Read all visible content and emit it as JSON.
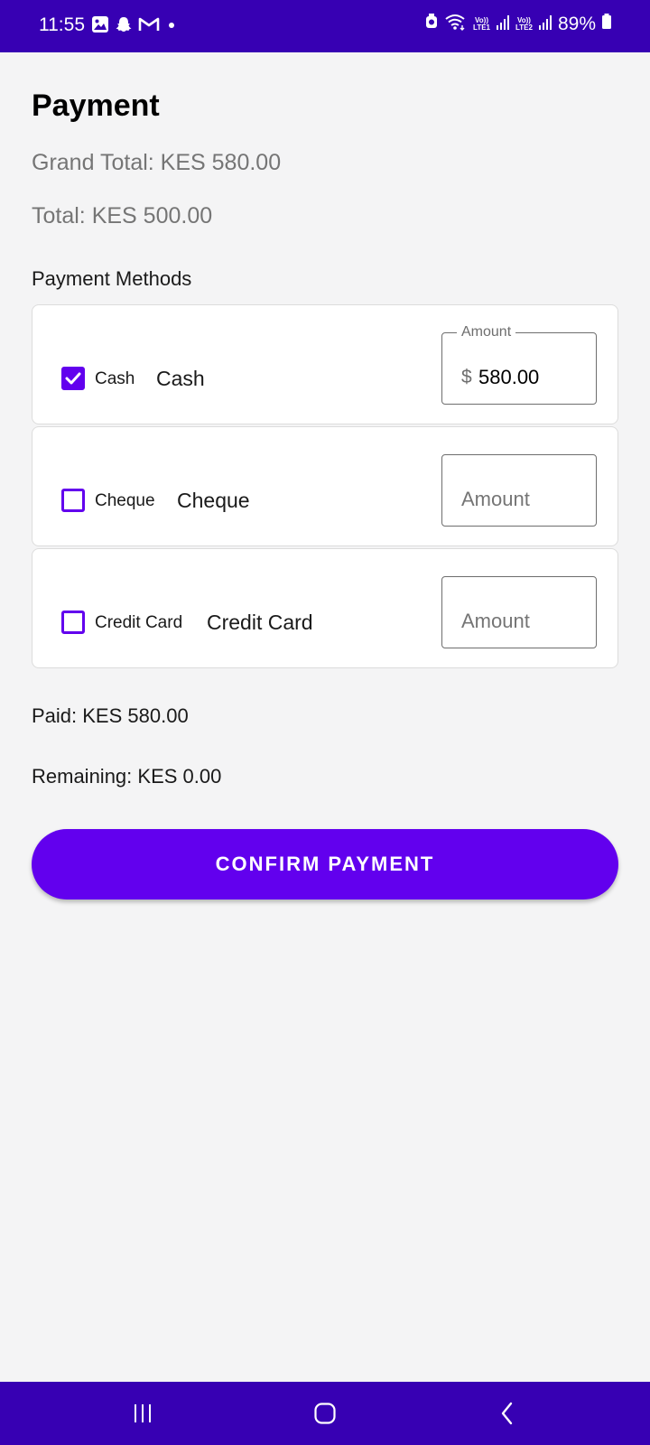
{
  "status_bar": {
    "time": "11:55",
    "battery": "89%",
    "sim1": "LTE1",
    "sim2": "LTE2",
    "volte": "Vo))"
  },
  "page": {
    "title": "Payment",
    "grand_total": "Grand Total: KES 580.00",
    "total": "Total: KES 500.00",
    "payment_methods_label": "Payment Methods"
  },
  "methods": [
    {
      "checkbox_label": "Cash",
      "name": "Cash",
      "checked": true,
      "amount_label": "Amount",
      "prefix": "$",
      "value": "580.00",
      "placeholder": ""
    },
    {
      "checkbox_label": "Cheque",
      "name": "Cheque",
      "checked": false,
      "amount_label": "Amount",
      "prefix": "",
      "value": "",
      "placeholder": "Amount"
    },
    {
      "checkbox_label": "Credit Card",
      "name": "Credit Card",
      "checked": false,
      "amount_label": "Amount",
      "prefix": "",
      "value": "",
      "placeholder": "Amount"
    }
  ],
  "summary": {
    "paid": "Paid: KES 580.00",
    "remaining": "Remaining: KES 0.00"
  },
  "confirm_button": "CONFIRM PAYMENT",
  "icons": {
    "status_left": [
      "gallery-icon",
      "snapchat-icon",
      "gmail-icon",
      "dot-icon"
    ],
    "status_right": [
      "alarm-icon",
      "wifi-icon",
      "signal-icon",
      "battery-icon"
    ],
    "nav": [
      "recents-icon",
      "home-icon",
      "back-icon"
    ]
  },
  "colors": {
    "system_bars": "#3700b3",
    "primary": "#6200ee",
    "background": "#f4f4f5"
  }
}
